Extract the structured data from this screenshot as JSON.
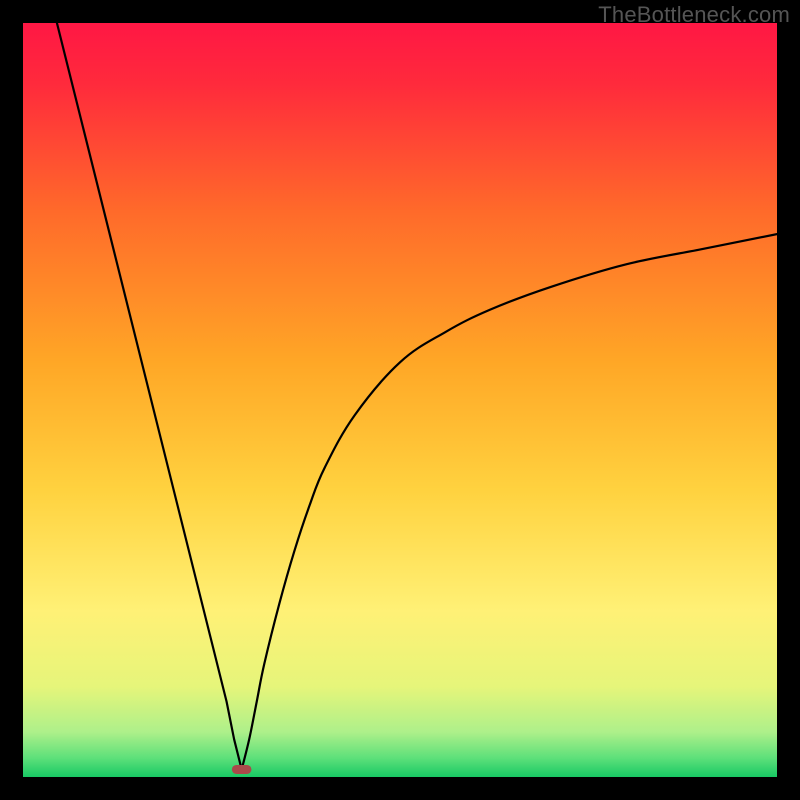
{
  "watermark": "TheBottleneck.com",
  "chart_data": {
    "type": "line",
    "title": "",
    "xlabel": "",
    "ylabel": "",
    "xlim": [
      0,
      100
    ],
    "ylim": [
      0,
      100
    ],
    "grid": false,
    "description": "V-shaped bottleneck curve over a vertical red→yellow→green gradient. Left branch descends steeply from top-left to a minimum near x≈29, right branch rises and levels off asymptotically toward ~72% by the right edge. Small dark-red pill marker at the minimum.",
    "minimum": {
      "x": 29,
      "y": 1
    },
    "series": [
      {
        "name": "left-branch",
        "x": [
          4.5,
          8,
          12,
          16,
          20,
          23,
          25,
          27,
          28,
          29
        ],
        "values": [
          100,
          86,
          70,
          54,
          38,
          26,
          18,
          10,
          5,
          1
        ]
      },
      {
        "name": "right-branch",
        "x": [
          29,
          30,
          31,
          32,
          34,
          36,
          38,
          40,
          44,
          50,
          56,
          62,
          70,
          80,
          90,
          100
        ],
        "values": [
          1,
          5,
          10,
          15,
          23,
          30,
          36,
          41,
          48,
          55,
          59,
          62,
          65,
          68,
          70,
          72
        ]
      }
    ],
    "marker": {
      "x": 29,
      "y": 1,
      "width": 2.6,
      "height": 1.2,
      "color": "#a94a4a"
    },
    "gradient": {
      "stops": [
        {
          "offset": 0.0,
          "color": "#ff1744"
        },
        {
          "offset": 0.08,
          "color": "#ff2a3c"
        },
        {
          "offset": 0.25,
          "color": "#ff6a2a"
        },
        {
          "offset": 0.45,
          "color": "#ffa726"
        },
        {
          "offset": 0.62,
          "color": "#ffd23f"
        },
        {
          "offset": 0.78,
          "color": "#fff176"
        },
        {
          "offset": 0.88,
          "color": "#e6f57a"
        },
        {
          "offset": 0.94,
          "color": "#aef08a"
        },
        {
          "offset": 0.975,
          "color": "#5de07a"
        },
        {
          "offset": 1.0,
          "color": "#18c964"
        }
      ]
    }
  }
}
